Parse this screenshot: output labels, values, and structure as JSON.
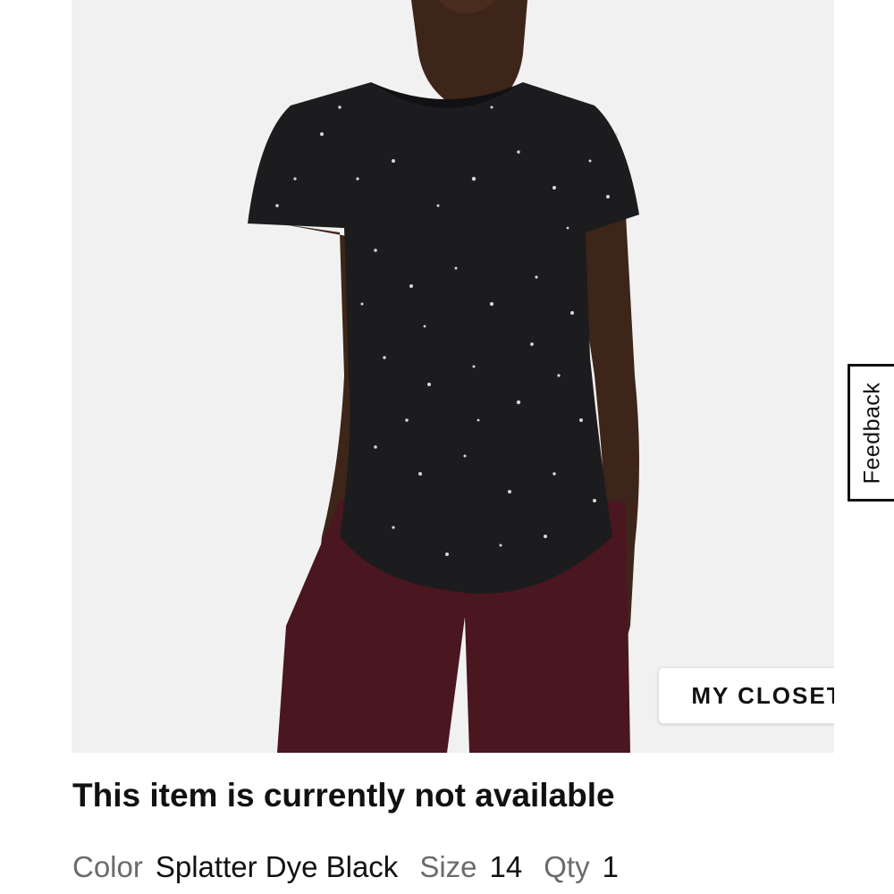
{
  "product": {
    "image_alt": "Woman wearing splatter dye black short sleeve tee with maroon pants",
    "closet_button_label": "MY CLOSET",
    "availability_text": "This item is currently not available",
    "details": {
      "color_label": "Color",
      "color_value": "Splatter Dye Black",
      "size_label": "Size",
      "size_value": "14",
      "qty_label": "Qty",
      "qty_value": "1"
    }
  },
  "feedback": {
    "label": "Feedback"
  },
  "colors": {
    "image_background": "#f1f1f1",
    "shirt": "#1c1c1e",
    "pants": "#4a1620",
    "skin": "#3e2519"
  }
}
